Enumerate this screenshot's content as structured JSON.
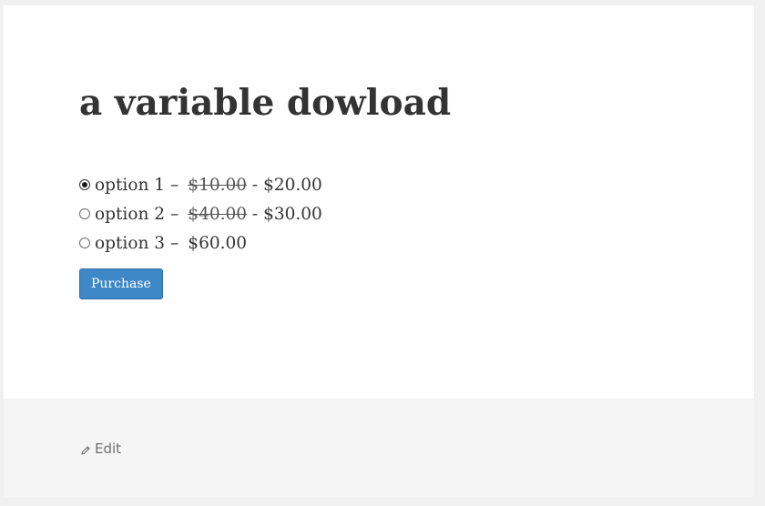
{
  "article": {
    "title": "a variable dowload"
  },
  "price_options": [
    {
      "label": "option 1",
      "dash": "–",
      "old_price": "$10.00",
      "separator": "-",
      "price": "$20.00",
      "selected": true
    },
    {
      "label": "option 2",
      "dash": "–",
      "old_price": "$40.00",
      "separator": "-",
      "price": "$30.00",
      "selected": false
    },
    {
      "label": "option 3",
      "dash": "–",
      "old_price": "",
      "separator": "",
      "price": "$60.00",
      "selected": false
    }
  ],
  "purchase_button": {
    "label": "Purchase"
  },
  "footer": {
    "edit_label": "Edit",
    "edit_icon": "pencil-icon"
  },
  "colors": {
    "button_bg": "#3f88c8",
    "footer_bg": "#f5f5f5",
    "page_bg": "#f1f1f1",
    "text": "#333333"
  }
}
